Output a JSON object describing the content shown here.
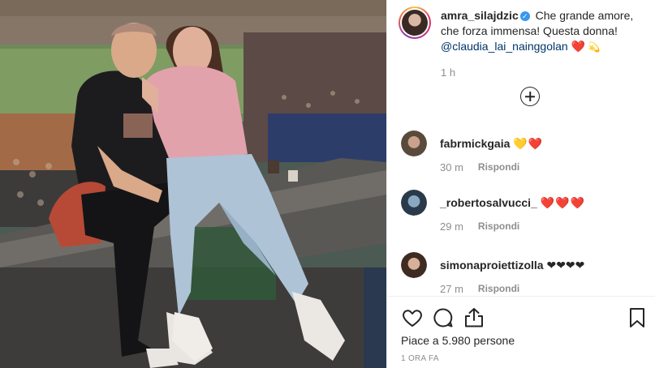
{
  "post": {
    "author": {
      "username": "amra_silajdzic",
      "verified": true
    },
    "caption": {
      "text_1": "Che grande amore, che forza immensa! Questa donna!",
      "mention": "@claudia_lai_nainggolan",
      "heart": "❤️",
      "sparkle": "💫"
    },
    "caption_age": "1 h",
    "likes_label": "Piace a 5.980 persone",
    "posted_label": "1 ORA FA"
  },
  "comments": [
    {
      "username": "fabrmickgaia",
      "emojis": "💛❤️",
      "age": "30 m",
      "reply_label": "Rispondi"
    },
    {
      "username": "_robertosalvucci_",
      "emojis": "❤️❤️❤️",
      "age": "29 m",
      "reply_label": "Rispondi"
    },
    {
      "username": "simonaproiettizolla",
      "emojis": "❤❤❤❤",
      "age": "27 m",
      "reply_label": "Rispondi"
    }
  ],
  "icons": {
    "load_more": "plus-circle-icon",
    "like": "heart-outline-icon",
    "comment": "comment-bubble-icon",
    "share": "share-arrow-icon",
    "save": "bookmark-icon",
    "verified": "verified-badge-icon"
  },
  "colors": {
    "text": "#262626",
    "muted": "#8e8e8e",
    "mention": "#003569",
    "verified": "#3897f0"
  }
}
